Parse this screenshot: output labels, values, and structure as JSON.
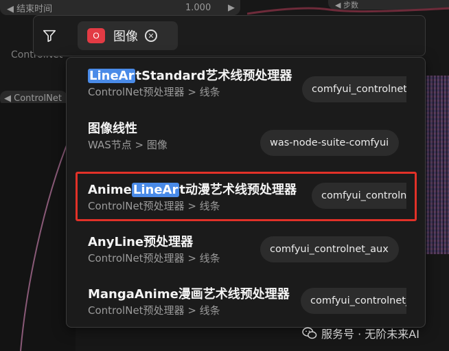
{
  "background": {
    "top_widget_left": "◀ 结束时间",
    "top_widget_value": "1.000",
    "top_widget_arrow": "▶",
    "top_right_widget": "◀ 步数",
    "controlnet_label": "ControlNet",
    "controlnet_widget": "◀ ControlNet"
  },
  "search": {
    "chip_badge": "O",
    "chip_label": "图像",
    "chip_close": "✕"
  },
  "results": [
    {
      "title_highlight": "LineAr",
      "title_rest": "tStandard艺术线预处理器",
      "category": "ControlNet预处理器 > 线条",
      "source": "comfyui_controlnet"
    },
    {
      "title": "图像线性",
      "category": "WAS节点 > 图像",
      "source": "was-node-suite-comfyui"
    },
    {
      "title_prefix": "Anime",
      "title_highlight": "LineAr",
      "title_rest": "t动漫艺术线预处理器",
      "category": "ControlNet预处理器 > 线条",
      "source": "comfyui_controln"
    },
    {
      "title": "AnyLine预处理器",
      "category": "ControlNet预处理器 > 线条",
      "source": "comfyui_controlnet_aux"
    },
    {
      "title": "MangaAnime漫画艺术线预处理器",
      "category": "ControlNet预处理器 > 线条",
      "source": "comfyui_controlnet_"
    }
  ],
  "watermark": {
    "text": "服务号 · 无阶未来AI"
  },
  "colors": {
    "highlight": "#4a8be8",
    "selection_frame": "#e23128",
    "badge": "#e33b44"
  }
}
